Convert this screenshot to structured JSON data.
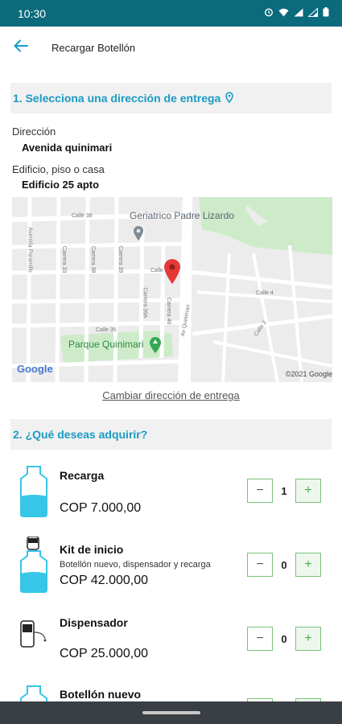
{
  "status_bar": {
    "time": "10:30"
  },
  "app_bar": {
    "title": "Recargar Botellón"
  },
  "section1": {
    "title": "1. Selecciona una dirección de entrega"
  },
  "address": {
    "direccion_label": "Dirección",
    "direccion_value": "Avenida quinimari",
    "edificio_label": "Edificio, piso o casa",
    "edificio_value": "Edificio 25 apto"
  },
  "map": {
    "labels": {
      "geriatrico": "Geriatrico Padre Lizardo",
      "parque": "Parque Quinimari",
      "calle38": "Calle 38",
      "calle35": "Calle 35",
      "calle4": "Calle 4",
      "calle2": "Calle 2",
      "carrera33": "Carrera 33",
      "carrera38": "Carrera 38",
      "carrera39": "Carrera 39",
      "carrera39a": "Carrera 39A",
      "carrera40": "Carrera 40",
      "avquinimari": "Av Quinimari",
      "avparamillo": "Avenida Paramillo",
      "calle_short": "Calle"
    },
    "google": "Google",
    "copyright": "©2021 Google"
  },
  "change_address": "Cambiar dirección de entrega",
  "section2": {
    "title": "2. ¿Qué deseas adquirir?"
  },
  "products": [
    {
      "name": "Recarga",
      "desc": "",
      "price": "COP  7.000,00",
      "qty": "1"
    },
    {
      "name": "Kit de inicio",
      "desc": "Botellón nuevo, dispensador y recarga",
      "price": "COP  42.000,00",
      "qty": "0"
    },
    {
      "name": "Dispensador",
      "desc": "",
      "price": "COP  25.000,00",
      "qty": "0"
    },
    {
      "name": "Botellón nuevo",
      "desc": "",
      "price": "",
      "qty": ""
    }
  ],
  "controls": {
    "minus": "−",
    "plus": "+"
  },
  "colors": {
    "status_bar": "#0b6b7d",
    "accent": "#1a9bc4",
    "button_border": "#7cc07c",
    "water": "#35c6e8"
  }
}
